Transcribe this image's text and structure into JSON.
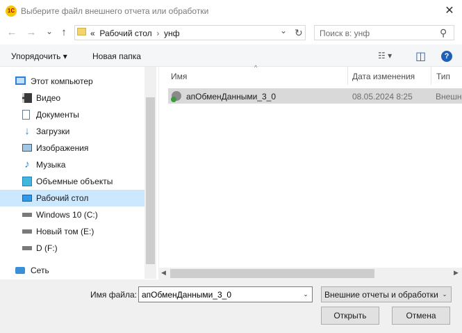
{
  "window": {
    "title": "Выберите файл внешнего отчета или обработки",
    "logo_text": "1С",
    "close_glyph": "✕"
  },
  "nav": {
    "back_glyph": "←",
    "forward_glyph": "→",
    "recent_glyph": "⌄",
    "up_glyph": "↑",
    "address_parts": [
      "«",
      "Рабочий стол",
      "›",
      "унф"
    ],
    "address_dropdown_glyph": "⌄",
    "refresh_glyph": "↻",
    "search_placeholder": "Поиск в: унф",
    "search_icon_glyph": "⚲"
  },
  "toolbar": {
    "organize_label": "Упорядочить ▾",
    "new_folder_label": "Новая папка",
    "view_glyph": "☷ ▾",
    "preview_glyph": "◫",
    "help_glyph": "?"
  },
  "sidebar": {
    "items": [
      {
        "label": "Этот компьютер",
        "icon": "computer-icon"
      },
      {
        "label": "Видео",
        "icon": "video-icon"
      },
      {
        "label": "Документы",
        "icon": "documents-icon"
      },
      {
        "label": "Загрузки",
        "icon": "downloads-icon"
      },
      {
        "label": "Изображения",
        "icon": "images-icon"
      },
      {
        "label": "Музыка",
        "icon": "music-icon"
      },
      {
        "label": "Объемные объекты",
        "icon": "3d-objects-icon"
      },
      {
        "label": "Рабочий стол",
        "icon": "desktop-icon",
        "selected": true
      },
      {
        "label": "Windows 10 (C:)",
        "icon": "drive-icon"
      },
      {
        "label": "Новый том (E:)",
        "icon": "drive-icon"
      },
      {
        "label": "D (F:)",
        "icon": "drive-icon"
      },
      {
        "label": "Сеть",
        "icon": "network-icon"
      }
    ]
  },
  "list": {
    "columns": [
      "Имя",
      "Дата изменения",
      "Тип"
    ],
    "sort_glyph": "^",
    "rows": [
      {
        "name": "апОбменДанными_3_0",
        "date": "08.05.2024 8:25",
        "type": "Внешн"
      }
    ]
  },
  "bottom": {
    "filename_label": "Имя файла:",
    "filename_value": "апОбменДанными_3_0",
    "filename_dd_glyph": "⌄",
    "filter_value": "Внешние отчеты и обработки",
    "filter_dd_glyph": "⌄",
    "open_label": "Открыть",
    "cancel_label": "Отмена"
  },
  "colors": {
    "selection": "#cce8ff",
    "row_highlight": "#d9d9d9",
    "bottom_bg": "#f0f0f0",
    "help_blue": "#1f5fb5"
  }
}
